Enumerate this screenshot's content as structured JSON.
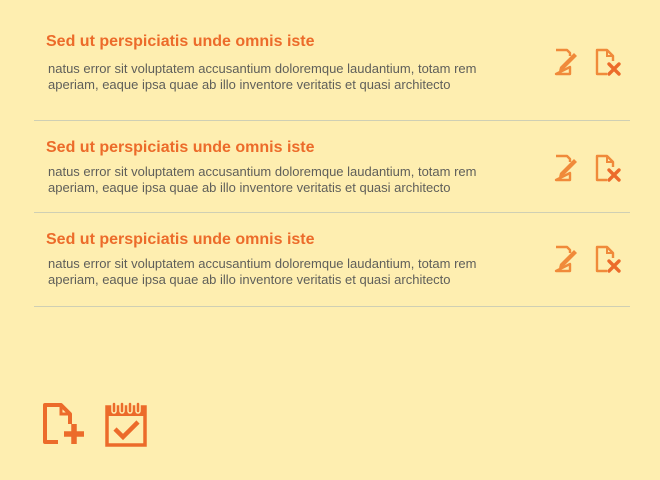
{
  "items": [
    {
      "title": "Sed ut perspiciatis unde omnis iste",
      "description": "natus error sit voluptatem accusantium doloremque laudantium, totam rem aperiam, eaque ipsa quae ab illo inventore veritatis et quasi architecto",
      "edit_icon": "edit-document-icon",
      "delete_icon": "delete-document-icon"
    },
    {
      "title": "Sed ut perspiciatis unde omnis iste",
      "description": "natus error sit voluptatem accusantium doloremque laudantium, totam rem aperiam, eaque ipsa quae ab illo inventore veritatis et quasi architecto",
      "edit_icon": "edit-document-icon",
      "delete_icon": "delete-document-icon"
    },
    {
      "title": "Sed ut perspiciatis unde omnis iste",
      "description": "natus error sit voluptatem accusantium doloremque laudantium, totam rem aperiam, eaque ipsa quae ab illo inventore veritatis et quasi architecto",
      "edit_icon": "edit-document-icon",
      "delete_icon": "delete-document-icon"
    }
  ],
  "toolbar": {
    "add_icon": "add-document-icon",
    "calendar_icon": "calendar-check-icon"
  },
  "colors": {
    "background": "#feeeb0",
    "accent": "#ec6b2a",
    "icon": "#f08a3a",
    "text": "#5f5f5a",
    "divider": "#cfcfb4"
  }
}
